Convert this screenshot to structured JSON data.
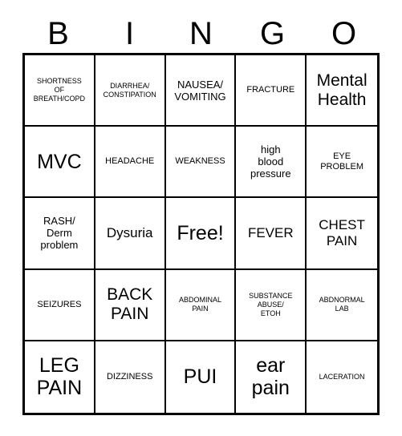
{
  "card": {
    "title": "BINGO",
    "header_letters": [
      "B",
      "I",
      "N",
      "G",
      "O"
    ],
    "colors": {
      "background": "#ffffff",
      "text": "#000000",
      "border": "#000000"
    },
    "grid": {
      "rows": 5,
      "columns": 5,
      "free_space_index": 12
    },
    "cells": [
      {
        "text": "SHORTNESS\nOF\nBREATH/COPD",
        "size": "xs"
      },
      {
        "text": "DIARRHEA/\nCONSTIPATION",
        "size": "xs"
      },
      {
        "text": "NAUSEA/\nVOMITING",
        "size": "m"
      },
      {
        "text": "FRACTURE",
        "size": "s"
      },
      {
        "text": "Mental\nHealth",
        "size": "xl"
      },
      {
        "text": "MVC",
        "size": "xxl"
      },
      {
        "text": "HEADACHE",
        "size": "s"
      },
      {
        "text": "WEAKNESS",
        "size": "s"
      },
      {
        "text": "high\nblood\npressure",
        "size": "m"
      },
      {
        "text": "EYE\nPROBLEM",
        "size": "s"
      },
      {
        "text": "RASH/\nDerm\nproblem",
        "size": "m"
      },
      {
        "text": "Dysuria",
        "size": "l"
      },
      {
        "text": "Free!",
        "size": "xxl"
      },
      {
        "text": "FEVER",
        "size": "l"
      },
      {
        "text": "CHEST\nPAIN",
        "size": "l"
      },
      {
        "text": "SEIZURES",
        "size": "s"
      },
      {
        "text": "BACK\nPAIN",
        "size": "xl"
      },
      {
        "text": "ABDOMINAL\nPAIN",
        "size": "xs"
      },
      {
        "text": "SUBSTANCE\nABUSE/\nETOH",
        "size": "xs"
      },
      {
        "text": "ABDNORMAL\nLAB",
        "size": "xs"
      },
      {
        "text": "LEG\nPAIN",
        "size": "xxl"
      },
      {
        "text": "DIZZINESS",
        "size": "s"
      },
      {
        "text": "PUI",
        "size": "xxl"
      },
      {
        "text": "ear\npain",
        "size": "xxl"
      },
      {
        "text": "LACERATION",
        "size": "xs"
      }
    ]
  }
}
